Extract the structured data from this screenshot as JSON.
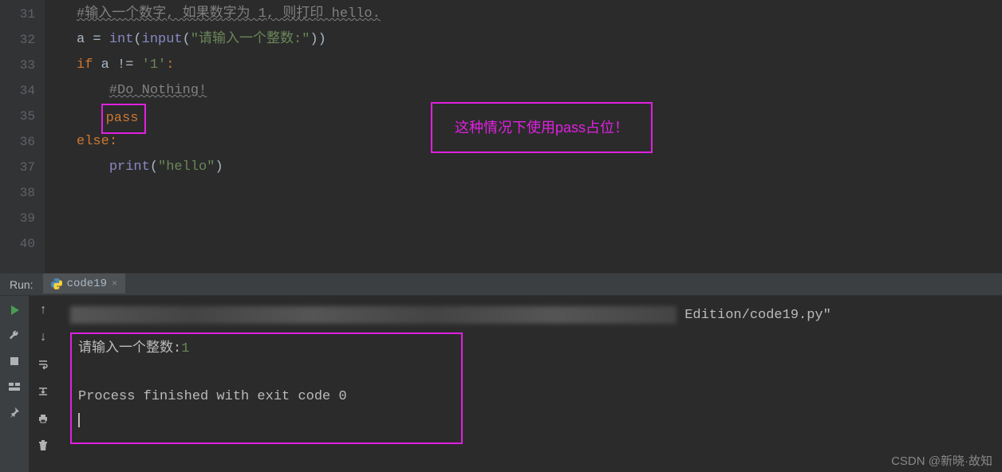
{
  "gutter": {
    "start": 31,
    "end": 40
  },
  "code": {
    "line31_comment": "#输入一个数字, 如果数字为 1, 则打印 hello.",
    "line32_a": "a = ",
    "line32_int": "int",
    "line32_input": "input",
    "line32_str": "\"请输入一个整数:\"",
    "line33_if": "if",
    "line33_cond": " a != ",
    "line33_val": "'1'",
    "line33_colon": ":",
    "line34_comment": "#Do Nothing!",
    "line35_pass": "pass",
    "line36_else": "else",
    "line36_colon": ":",
    "line37_print": "print",
    "line37_str": "\"hello\""
  },
  "annotation": "这种情况下使用pass占位！",
  "run": {
    "label": "Run:",
    "tab_name": "code19",
    "console_path_suffix": " Edition/code19.py\"",
    "prompt_text": "请输入一个整数:",
    "input_value": "1",
    "finished": "Process finished with exit code 0"
  },
  "watermark": "CSDN @新晓·故知"
}
